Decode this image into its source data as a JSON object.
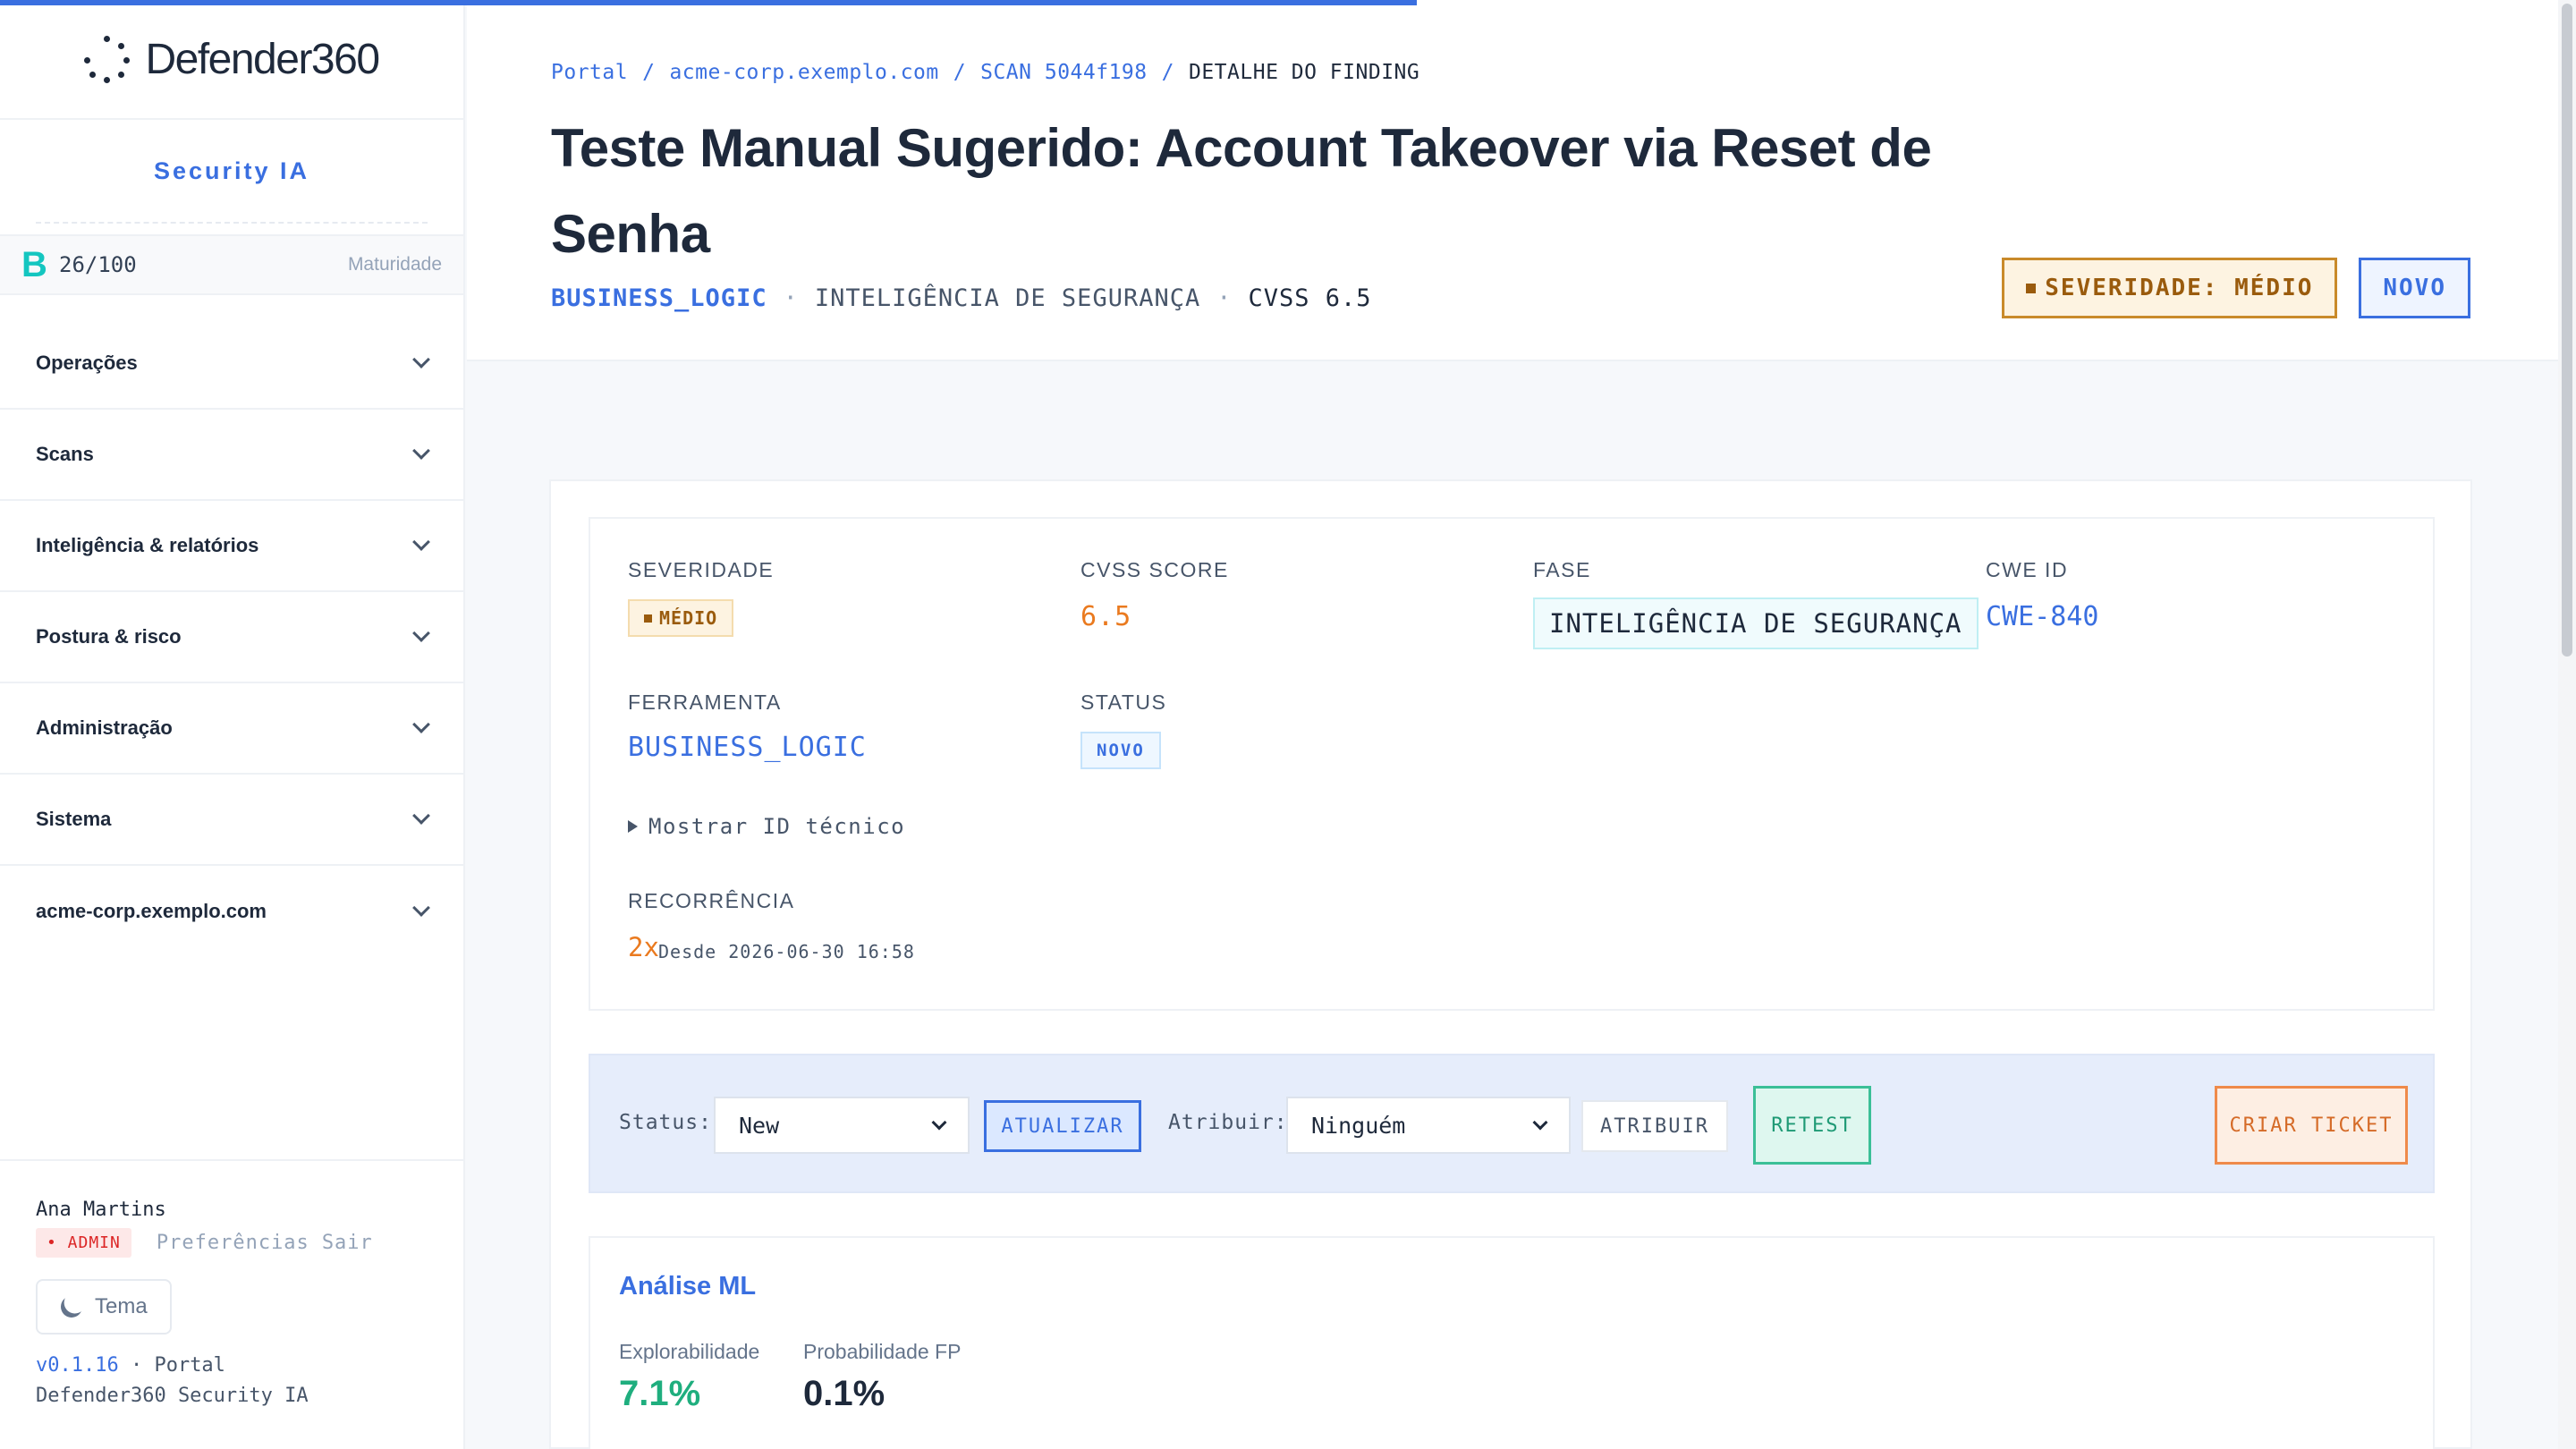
{
  "progress": 0.55,
  "sidebar": {
    "logo_text": "Defender360",
    "section_title": "Security IA",
    "maturity": {
      "grade": "B",
      "score": "26/100",
      "label": "Maturidade"
    },
    "nav": [
      {
        "label": "Operações"
      },
      {
        "label": "Scans"
      },
      {
        "label": "Inteligência & relatórios"
      },
      {
        "label": "Postura & risco"
      },
      {
        "label": "Administração"
      },
      {
        "label": "Sistema"
      },
      {
        "label": "acme-corp.exemplo.com"
      }
    ],
    "footer": {
      "user_name": "Ana Martins",
      "role_badge": "• ADMIN",
      "preferences": "Preferências",
      "logout": "Sair",
      "theme": "Tema",
      "version": "v0.1.16",
      "version_suffix": " · Portal",
      "product": "Defender360 Security IA"
    }
  },
  "breadcrumb": {
    "items": [
      "Portal",
      "acme-corp.exemplo.com",
      "SCAN 5044f198"
    ],
    "separator": "/",
    "current": "DETALHE DO FINDING"
  },
  "header": {
    "title": "Teste Manual Sugerido: Account Takeover via Reset de Senha",
    "tool": "BUSINESS_LOGIC",
    "dot": "·",
    "phase": "INTELIGÊNCIA DE SEGURANÇA",
    "cvss": "CVSS 6.5",
    "severity_badge": "SEVERIDADE: MÉDIO",
    "status_badge": "NOVO"
  },
  "details": {
    "severity_label": "SEVERIDADE",
    "severity_value": "MÉDIO",
    "cvss_label": "CVSS SCORE",
    "cvss_value": "6.5",
    "phase_label": "FASE",
    "phase_value": "INTELIGÊNCIA DE SEGURANÇA",
    "cwe_label": "CWE ID",
    "cwe_value": "CWE-840",
    "tool_label": "FERRAMENTA",
    "tool_value": "BUSINESS_LOGIC",
    "status_label": "STATUS",
    "status_value": "NOVO",
    "show_id": "Mostrar ID técnico",
    "recurrence_label": "RECORRÊNCIA",
    "recurrence_count": "2x",
    "recurrence_since": "Desde 2026-06-30 16:58"
  },
  "actions": {
    "status_label": "Status:",
    "status_value": "New",
    "update_button": "ATUALIZAR",
    "assign_label": "Atribuir:",
    "assign_value": "Ninguém",
    "assign_button": "ATRIBUIR",
    "retest_button": "RETEST",
    "ticket_button": "CRIAR TICKET"
  },
  "ml": {
    "title": "Análise ML",
    "exploitability_label": "Explorabilidade",
    "exploitability_value": "7.1%",
    "fp_label": "Probabilidade FP",
    "fp_value": "0.1%"
  },
  "colors": {
    "accent": "#3a6fe0",
    "severity": "#9a5b0d",
    "cvss": "#ea7a1f",
    "maturity_grade": "#14c6c0",
    "exploitability": "#1fae7e"
  }
}
